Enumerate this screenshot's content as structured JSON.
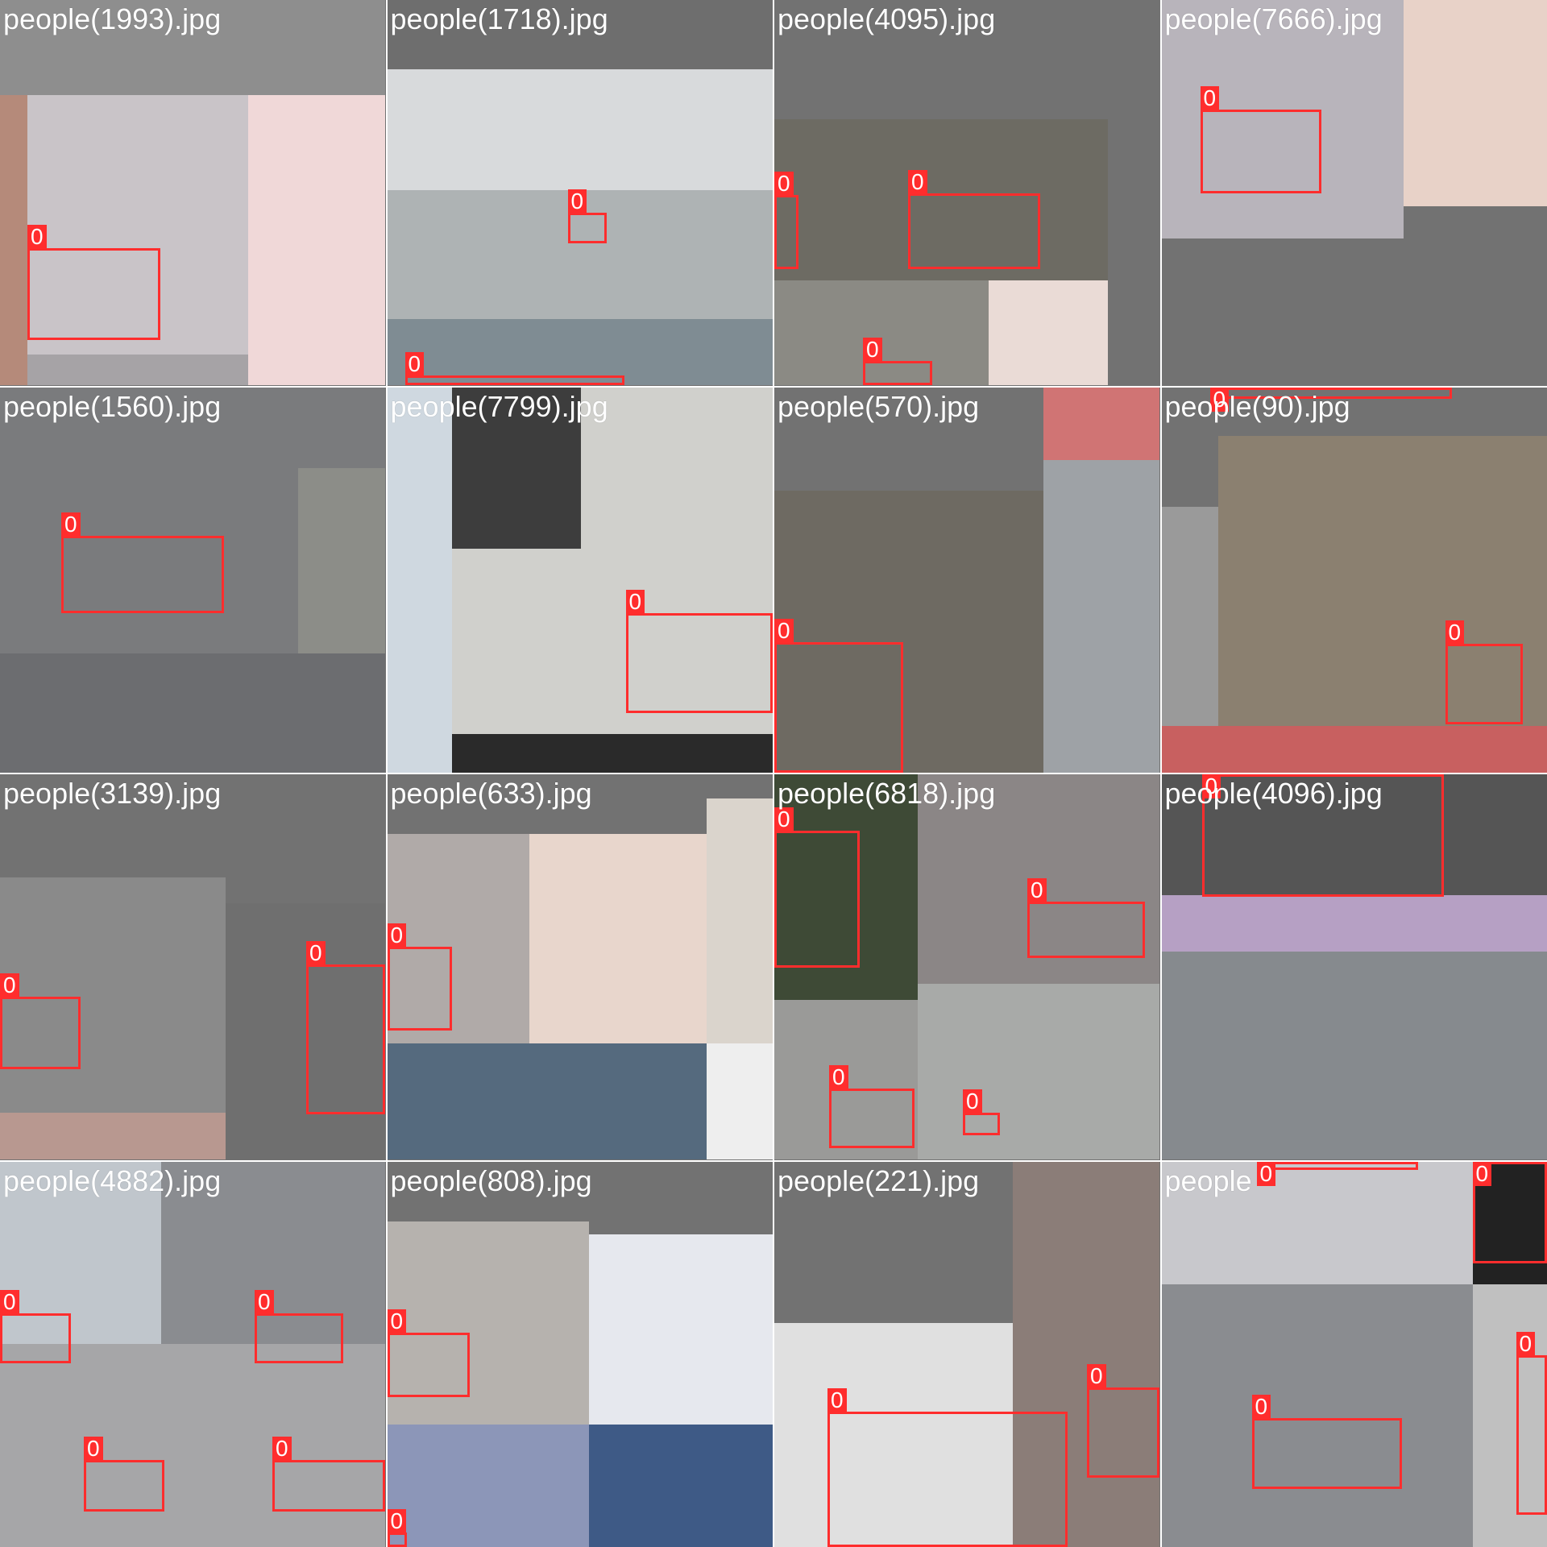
{
  "colors": {
    "box": "#ff2d2d",
    "label_text": "#ffffff",
    "tile_background": "#727272"
  },
  "tiles": [
    {
      "title": "people(1993).jpg",
      "labels": [
        "0"
      ]
    },
    {
      "title": "people(1718).jpg",
      "labels": [
        "0",
        "0"
      ]
    },
    {
      "title": "people(4095).jpg",
      "labels": [
        "0",
        "0",
        "0"
      ]
    },
    {
      "title": "people(7666).jpg",
      "labels": [
        "0"
      ]
    },
    {
      "title": "people(1560).jpg",
      "labels": [
        "0"
      ]
    },
    {
      "title": "people(7799).jpg",
      "labels": [
        "0"
      ]
    },
    {
      "title": "people(570).jpg",
      "labels": [
        "0"
      ]
    },
    {
      "title": "people(90).jpg",
      "labels": [
        "0",
        "0"
      ]
    },
    {
      "title": "people(3139).jpg",
      "labels": [
        "0",
        "0"
      ]
    },
    {
      "title": "people(633).jpg",
      "labels": [
        "0"
      ]
    },
    {
      "title": "people(6818).jpg",
      "labels": [
        "0",
        "0",
        "0",
        "0"
      ]
    },
    {
      "title": "people(4096).jpg",
      "labels": [
        "0"
      ]
    },
    {
      "title": "people(4882).jpg",
      "labels": [
        "0",
        "0",
        "0",
        "0"
      ]
    },
    {
      "title": "people(808).jpg",
      "labels": [
        "0",
        "0"
      ]
    },
    {
      "title": "people(221).jpg",
      "labels": [
        "0",
        "0"
      ]
    },
    {
      "title": "people",
      "labels": [
        "0",
        "0",
        "0",
        "0",
        "0"
      ]
    }
  ]
}
